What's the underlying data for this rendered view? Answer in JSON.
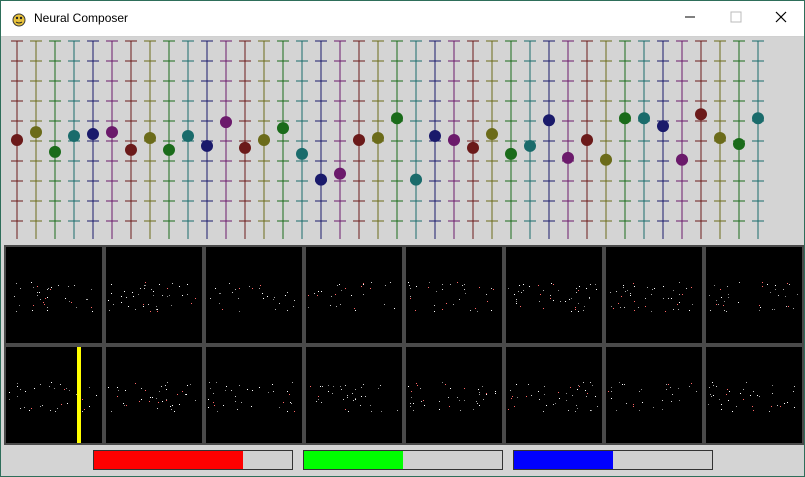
{
  "window": {
    "title": "Neural Composer"
  },
  "icons": {
    "app": "pygame-snake-icon",
    "minimize": "minimize-icon",
    "maximize": "maximize-icon",
    "close": "close-icon"
  },
  "colors": {
    "slider_palette": [
      "#6b1a1a",
      "#6b6b1a",
      "#1a6b1a",
      "#1a6b6b",
      "#1a1a6b",
      "#6b1a6b"
    ],
    "playhead": "#ffff00",
    "bars": [
      "#ff0000",
      "#00ff00",
      "#0000ff"
    ]
  },
  "sliders": {
    "count": 40,
    "levels": [
      0.5,
      0.54,
      0.44,
      0.52,
      0.53,
      0.54,
      0.45,
      0.51,
      0.45,
      0.52,
      0.47,
      0.59,
      0.46,
      0.5,
      0.56,
      0.43,
      0.3,
      0.33,
      0.5,
      0.51,
      0.61,
      0.3,
      0.52,
      0.5,
      0.46,
      0.53,
      0.43,
      0.47,
      0.6,
      0.41,
      0.5,
      0.4,
      0.61,
      0.61,
      0.57,
      0.4,
      0.63,
      0.51,
      0.48,
      0.61
    ],
    "colors": [
      0,
      1,
      2,
      3,
      4,
      5,
      0,
      1,
      2,
      3,
      4,
      5,
      0,
      1,
      2,
      3,
      4,
      5,
      0,
      1,
      2,
      3,
      4,
      5,
      0,
      1,
      2,
      3,
      4,
      5,
      0,
      1,
      2,
      3,
      4,
      5,
      0,
      1,
      2,
      3
    ]
  },
  "grid": {
    "rows": 2,
    "cols": 8,
    "playhead_row": 1,
    "playhead_col": 0
  },
  "bars": [
    {
      "name": "red",
      "color": "#ff0000",
      "level": 0.75
    },
    {
      "name": "green",
      "color": "#00ff00",
      "level": 0.5
    },
    {
      "name": "blue",
      "color": "#0000ff",
      "level": 0.5
    }
  ]
}
